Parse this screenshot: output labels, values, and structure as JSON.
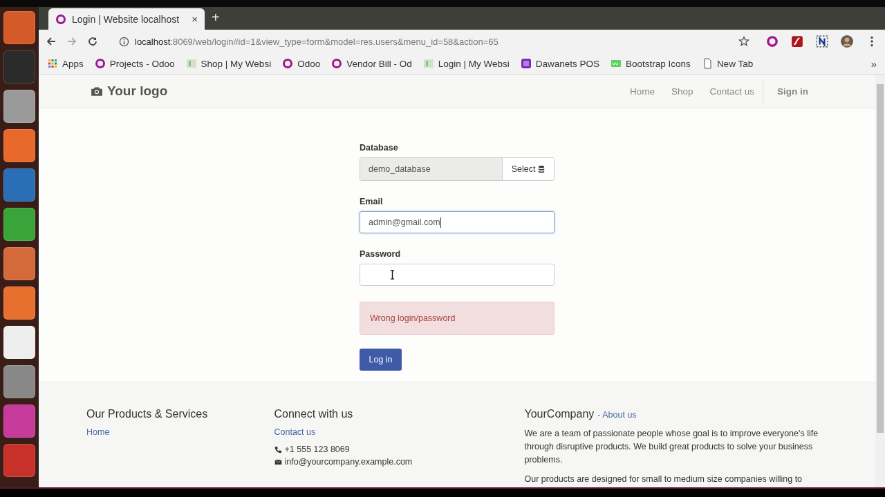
{
  "browser": {
    "tab": {
      "title": "Login | Website localhost",
      "close": "×"
    },
    "new_tab": "+",
    "url": {
      "host": "localhost",
      "rest": ":8069/web/login#id=1&view_type=form&model=res.users&menu_id=58&action=65"
    },
    "bookmarks": [
      {
        "label": "Apps",
        "kind": "apps"
      },
      {
        "label": "Projects - Odoo",
        "kind": "odoo"
      },
      {
        "label": "Shop | My Websi",
        "kind": "thumb"
      },
      {
        "label": "Odoo",
        "kind": "odoo"
      },
      {
        "label": "Vendor Bill - Od",
        "kind": "odoo"
      },
      {
        "label": "Login | My Websi",
        "kind": "thumb"
      },
      {
        "label": "Dawanets POS",
        "kind": "pos"
      },
      {
        "label": "Bootstrap Icons",
        "kind": "w3"
      },
      {
        "label": "New Tab",
        "kind": "page"
      }
    ],
    "more": "»"
  },
  "header": {
    "logo": "Your logo",
    "nav": [
      {
        "label": "Home"
      },
      {
        "label": "Shop"
      },
      {
        "label": "Contact us"
      }
    ],
    "sign_in": "Sign in"
  },
  "form": {
    "database": {
      "label": "Database",
      "value": "demo_database",
      "button": "Select"
    },
    "email": {
      "label": "Email",
      "value": "admin@gmail.com",
      "focused": true
    },
    "password": {
      "label": "Password",
      "focused": false
    },
    "error": "Wrong login/password",
    "submit": "Log in"
  },
  "footer": {
    "col1": {
      "title": "Our Products & Services",
      "links": [
        "Home"
      ]
    },
    "col2": {
      "title": "Connect with us",
      "link": "Contact us",
      "phone": "+1 555 123 8069",
      "email": "info@yourcompany.example.com"
    },
    "col3": {
      "title": "YourCompany",
      "link": "- About us",
      "paragraphs": [
        "We are a team of passionate people whose goal is to improve everyone's life through disruptive products. We build great products to solve your business problems.",
        "Our products are designed for small to medium size companies willing to"
      ]
    }
  }
}
